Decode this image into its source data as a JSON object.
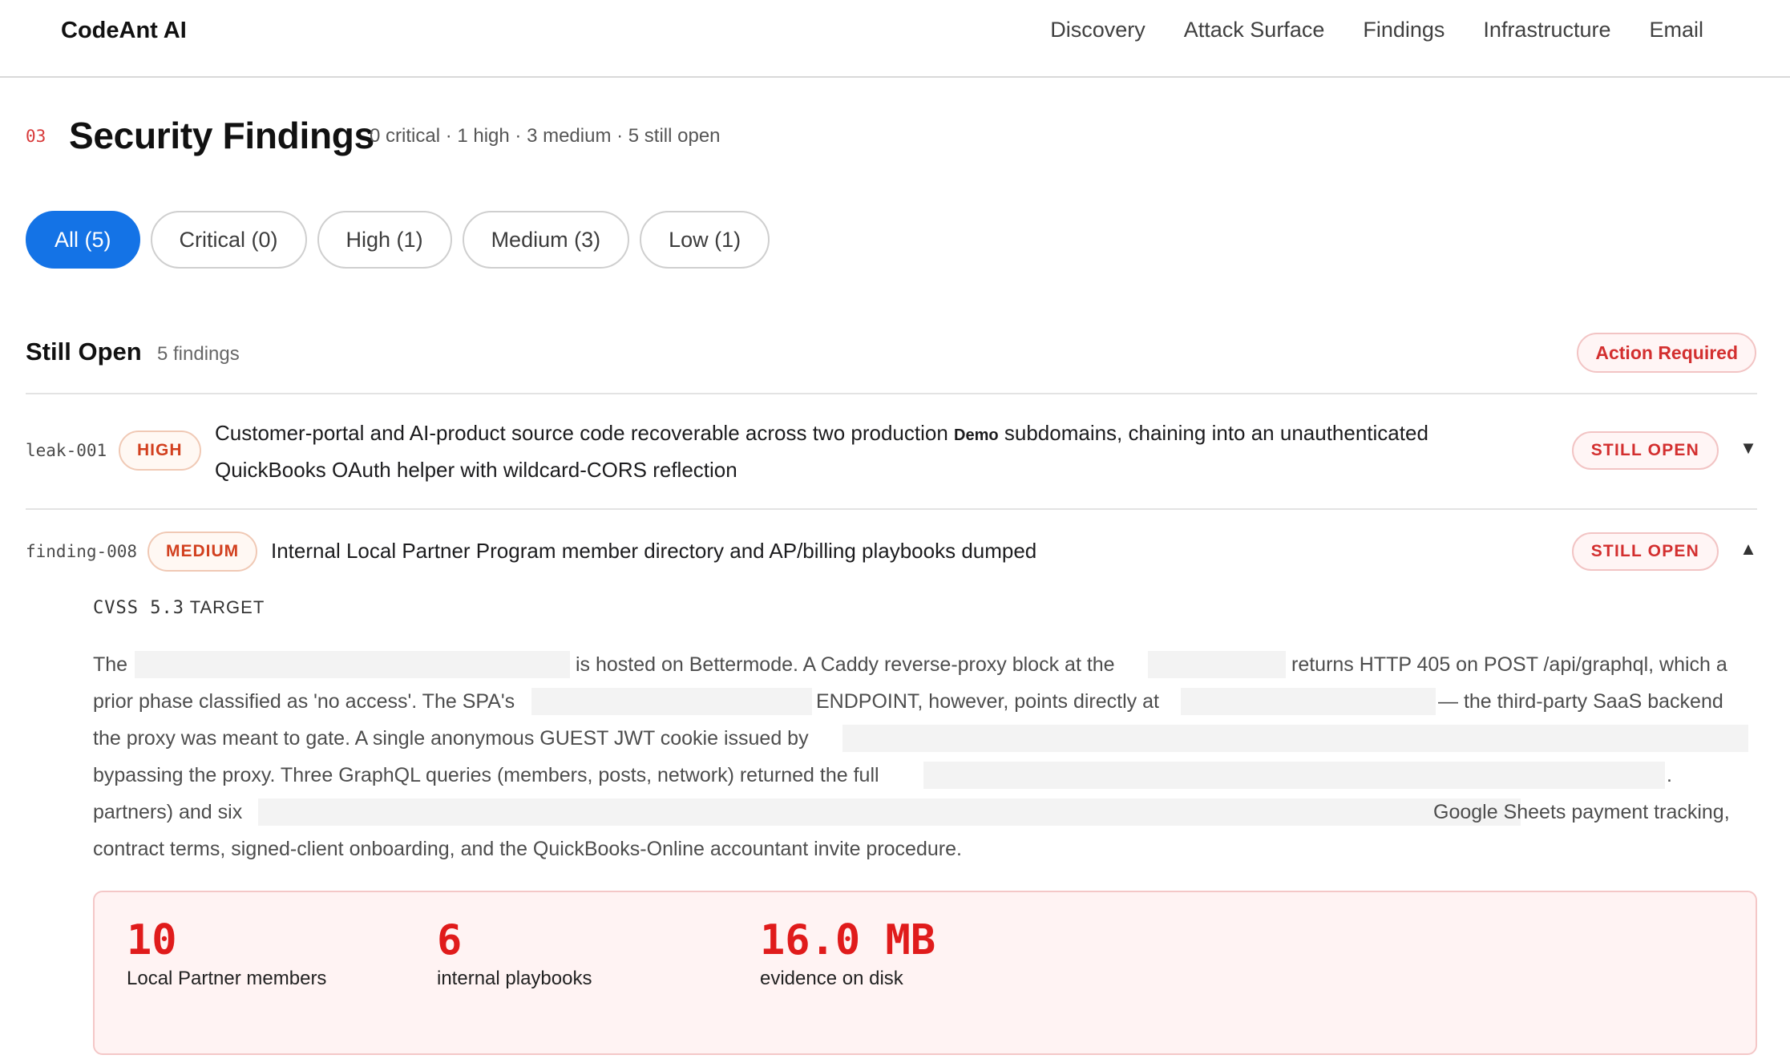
{
  "app": {
    "brand": "CodeAnt AI"
  },
  "nav": {
    "items": [
      {
        "label": "Discovery"
      },
      {
        "label": "Attack Surface"
      },
      {
        "label": "Findings"
      },
      {
        "label": "Infrastructure"
      },
      {
        "label": "Email"
      }
    ]
  },
  "page": {
    "section_number": "03",
    "title": "Security Findings",
    "summary": "0 critical · 1 high · 3 medium · 5 still open"
  },
  "filters": [
    {
      "label": "All (5)",
      "active": true
    },
    {
      "label": "Critical (0)",
      "active": false
    },
    {
      "label": "High (1)",
      "active": false
    },
    {
      "label": "Medium (3)",
      "active": false
    },
    {
      "label": "Low (1)",
      "active": false
    }
  ],
  "group": {
    "title": "Still Open",
    "count": "5 findings",
    "badge": "Action Required"
  },
  "findings": [
    {
      "id": "leak-001",
      "severity": "HIGH",
      "title_line1_a": "Customer-portal and AI-product source code recoverable across two production",
      "title_demo": "Demo",
      "title_line1_b": "subdomains, chaining into an unauthenticated",
      "title_line2": "QuickBooks OAuth helper with wildcard-CORS reflection",
      "status": "STILL OPEN",
      "chevron": "▼",
      "expanded": false
    },
    {
      "id": "finding-008",
      "severity": "MEDIUM",
      "title": "Internal Local Partner Program member directory and AP/billing playbooks dumped",
      "status": "STILL OPEN",
      "chevron": "▲",
      "expanded": true,
      "cvss_label": "CVSS 5.3",
      "target_label": "TARGET",
      "description": {
        "l1_a": "The",
        "l1_b": "is hosted on Bettermode. A Caddy reverse-proxy block at the",
        "l1_c": "returns HTTP 405 on POST /api/graphql, which a",
        "l2_a": "prior phase classified as 'no access'. The SPA's",
        "l2_b": "ENDPOINT, however, points directly at",
        "l2_c": "— the third-party SaaS backend",
        "l3_a": "the proxy was meant to gate. A single anonymous GUEST JWT cookie issued by",
        "l4_a": "bypassing the proxy. Three GraphQL queries (members, posts, network) returned the full",
        "l4_b": ".",
        "l5_a": "partners) and six",
        "l5_b": "Google Sheets payment tracking,",
        "l6_a": "contract terms, signed-client onboarding, and the QuickBooks-Online accountant invite procedure."
      },
      "stats": [
        {
          "value": "10",
          "label": "Local Partner members"
        },
        {
          "value": "6",
          "label": "internal playbooks"
        },
        {
          "value": "16.0 MB",
          "label": "evidence on disk"
        }
      ]
    }
  ],
  "colors": {
    "accent": "#1473e6",
    "danger": "#d32f2f",
    "stat_value": "#e01b1b",
    "stats_bg": "#fff3f3"
  }
}
